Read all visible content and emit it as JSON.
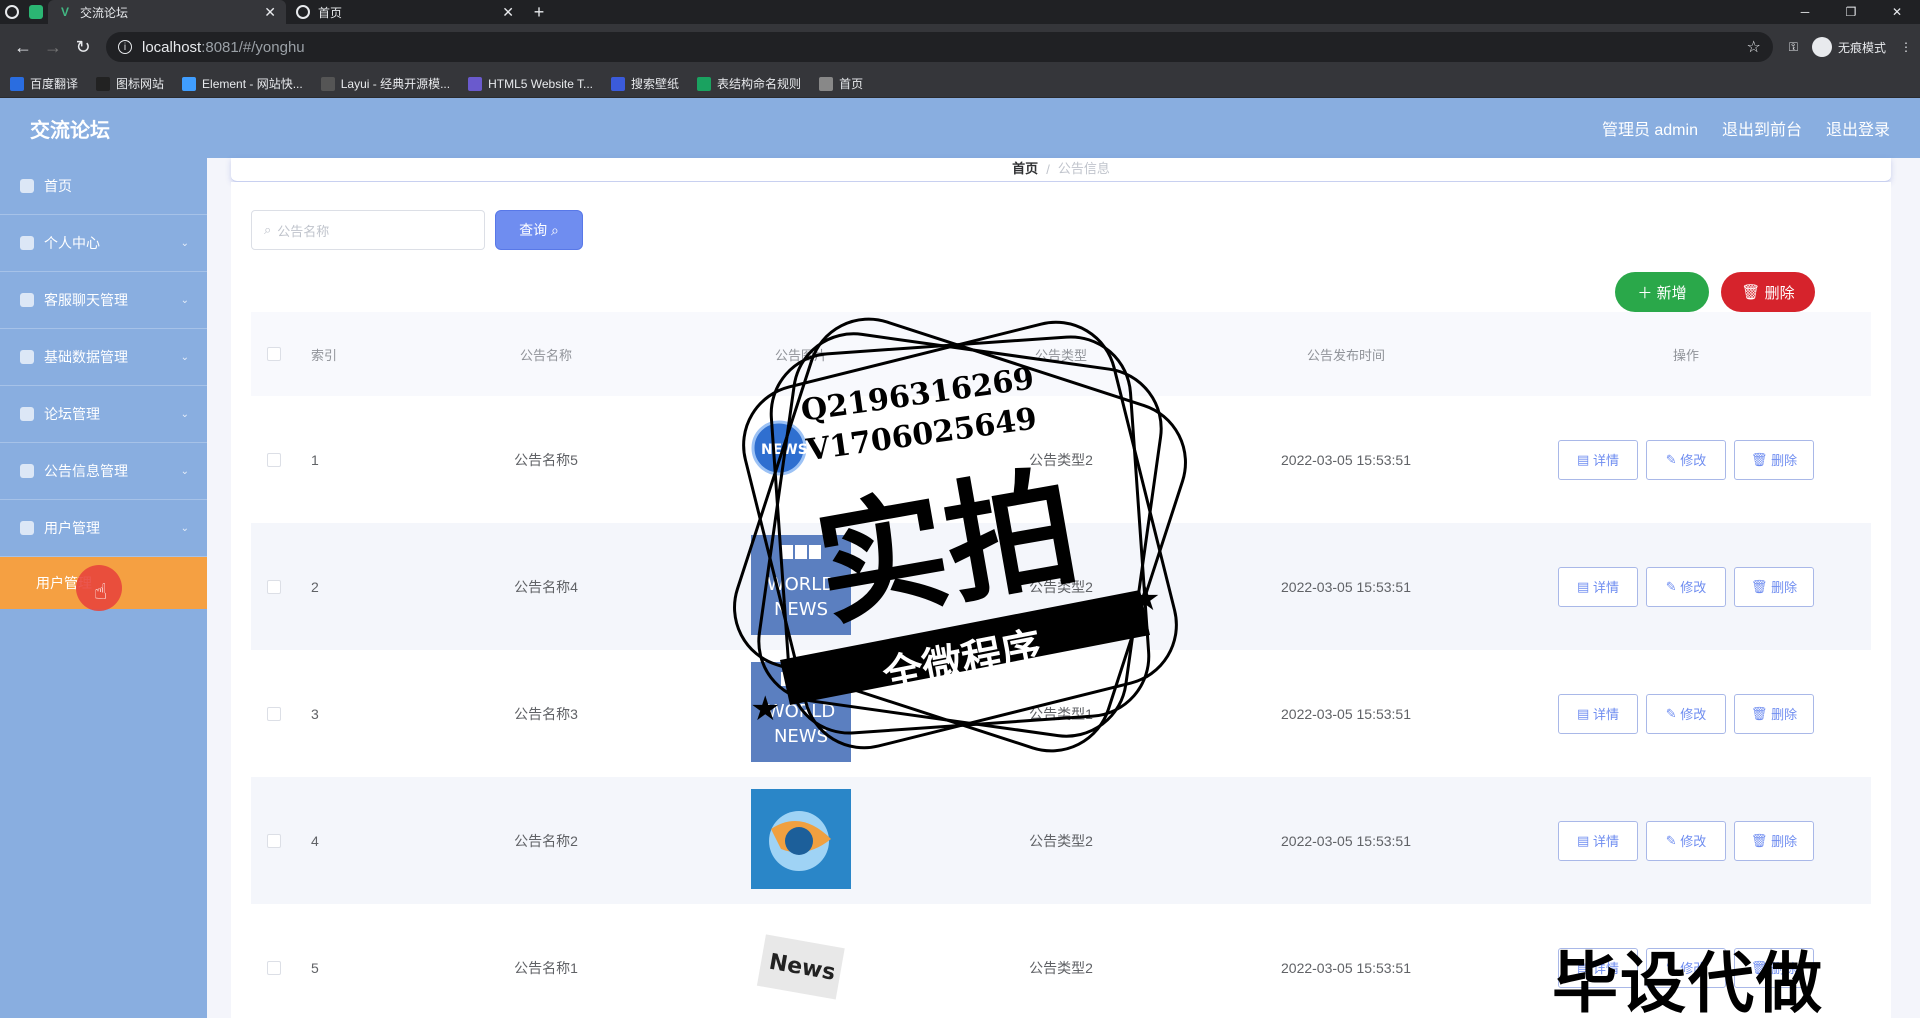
{
  "browser": {
    "tabs": [
      {
        "title": "交流论坛",
        "active": true
      },
      {
        "title": "首页",
        "active": false
      }
    ],
    "url_host": "localhost",
    "url_path": ":8081/#/yonghu",
    "incognito_label": "无痕模式",
    "bookmarks": [
      {
        "label": "百度翻译",
        "color": "#2a6de0"
      },
      {
        "label": "图标网站",
        "color": "#222222"
      },
      {
        "label": "Element - 网站快...",
        "color": "#409eff"
      },
      {
        "label": "Layui - 经典开源模...",
        "color": "#555555"
      },
      {
        "label": "HTML5 Website T...",
        "color": "#6a5acd"
      },
      {
        "label": "搜索壁纸",
        "color": "#3b5bdb"
      },
      {
        "label": "表结构命名规则",
        "color": "#1aa260"
      },
      {
        "label": "首页",
        "color": "#888888"
      }
    ]
  },
  "app": {
    "title": "交流论坛",
    "header_links": [
      "管理员 admin",
      "退出到前台",
      "退出登录"
    ]
  },
  "sidebar": {
    "items": [
      {
        "label": "首页",
        "has_arrow": false
      },
      {
        "label": "个人中心",
        "has_arrow": true
      },
      {
        "label": "客服聊天管理",
        "has_arrow": true
      },
      {
        "label": "基础数据管理",
        "has_arrow": true
      },
      {
        "label": "论坛管理",
        "has_arrow": true
      },
      {
        "label": "公告信息管理",
        "has_arrow": true
      },
      {
        "label": "用户管理",
        "has_arrow": true
      }
    ],
    "active_sub": "用户管理"
  },
  "breadcrumb": {
    "home": "首页",
    "current": "公告信息"
  },
  "toolbar": {
    "search_placeholder": "公告名称",
    "query_label": "查询",
    "add_label": "新增",
    "delete_label": "删除"
  },
  "table": {
    "headers": [
      "索引",
      "公告名称",
      "公告图片",
      "公告类型",
      "公告发布时间",
      "操作"
    ],
    "ops": [
      "详情",
      "修改",
      "删除"
    ],
    "rows": [
      {
        "index": "1",
        "name": "公告名称5",
        "image": "news-globe",
        "type": "公告类型2",
        "time": "2022-03-05 15:53:51"
      },
      {
        "index": "2",
        "name": "公告名称4",
        "image": "bbc-world-news",
        "type": "公告类型2",
        "time": "2022-03-05 15:53:51"
      },
      {
        "index": "3",
        "name": "公告名称3",
        "image": "bbc-world-news",
        "type": "公告类型1",
        "time": "2022-03-05 15:53:51"
      },
      {
        "index": "4",
        "name": "公告名称2",
        "image": "news-abstract-blue",
        "type": "公告类型2",
        "time": "2022-03-05 15:53:51"
      },
      {
        "index": "5",
        "name": "公告名称1",
        "image": "news-paper",
        "type": "公告类型2",
        "time": "2022-03-05 15:53:51"
      }
    ]
  },
  "watermark": {
    "line1": "Q2196316269",
    "line2": "V1706025649",
    "main": "实拍",
    "ribbon": "全微程序",
    "bottom": "毕设代做"
  },
  "colors": {
    "header": "#89aee0",
    "active_menu": "#f5a042",
    "primary": "#6f8df0",
    "success": "#2aa84a",
    "danger": "#d6232c"
  }
}
